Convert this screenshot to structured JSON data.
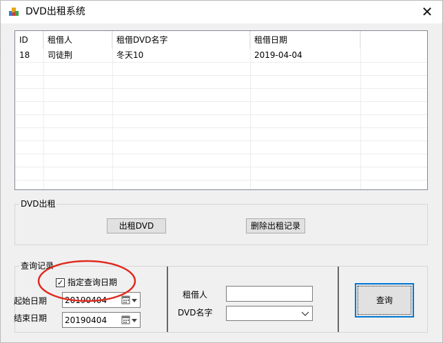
{
  "window": {
    "title": "DVD出租系统",
    "close_glyph": "✕",
    "side_glyph": ":"
  },
  "list": {
    "columns": [
      "ID",
      "租借人",
      "租借DVD名字",
      "租借日期"
    ],
    "rows": [
      {
        "id": "18",
        "renter": "司徒荆",
        "dvd": "冬天10",
        "date": "2019-04-04"
      }
    ]
  },
  "rent_group": {
    "label": "DVD出租",
    "rent_button": "出租DVD",
    "delete_button": "删除出租记录"
  },
  "query_group": {
    "label": "查询记录",
    "specify_date_checkbox": {
      "label": "指定查询日期",
      "checked": true,
      "glyph": "✓"
    },
    "start_date_label": "起始日期",
    "start_date_value": "20190404",
    "end_date_label": "结束日期",
    "end_date_value": "20190404",
    "renter_label": "租借人",
    "renter_value": "",
    "dvd_name_label": "DVD名字",
    "dvd_name_value": "",
    "query_button": "查询"
  },
  "colors": {
    "annotation": "#e02a1f",
    "focus": "#0078d7"
  }
}
